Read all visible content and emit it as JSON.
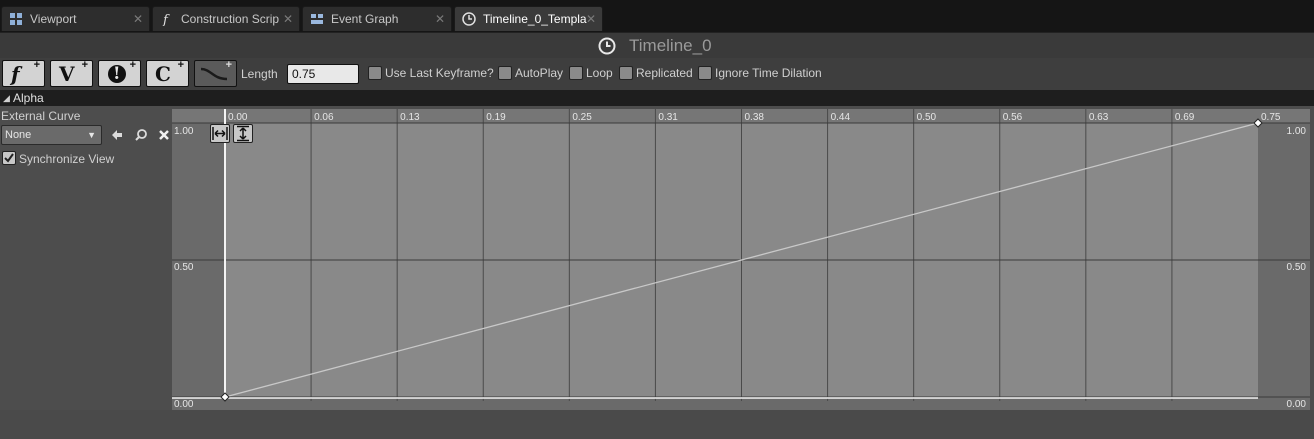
{
  "tabs": [
    {
      "label": "Viewport",
      "icon": "viewport-icon",
      "active": false
    },
    {
      "label": "Construction Scrip",
      "icon": "function-icon",
      "active": false
    },
    {
      "label": "Event Graph",
      "icon": "event-graph-icon",
      "active": false
    },
    {
      "label": "Timeline_0_Templa",
      "icon": "clock-icon",
      "active": true
    }
  ],
  "close_glyph": "✕",
  "title": "Timeline_0",
  "toolbar": {
    "add_float_track": "f",
    "add_vector_track": "V",
    "add_event_track": "!",
    "add_color_track": "C",
    "plus": "+",
    "length_label": "Length",
    "length_value": "0.75",
    "options": [
      {
        "label": "Use Last Keyframe?",
        "checked": false
      },
      {
        "label": "AutoPlay",
        "checked": false
      },
      {
        "label": "Loop",
        "checked": false
      },
      {
        "label": "Replicated",
        "checked": false
      },
      {
        "label": "Ignore Time Dilation",
        "checked": false
      }
    ]
  },
  "track": {
    "name": "Alpha",
    "external_curve_label": "External Curve",
    "external_curve_value": "None",
    "synchronize_label": "Synchronize View",
    "synchronize_checked": true
  },
  "graph": {
    "x_ticks": [
      "0.00",
      "0.06",
      "0.13",
      "0.19",
      "0.25",
      "0.31",
      "0.38",
      "0.44",
      "0.50",
      "0.56",
      "0.63",
      "0.69",
      "0.75"
    ],
    "y_labels_left": [
      "1.00",
      "0.50",
      "0.00"
    ],
    "y_labels_right": [
      "1.00",
      "0.50",
      "0.00"
    ],
    "keys": [
      {
        "time": 0.0,
        "value": 0.0
      },
      {
        "time": 0.75,
        "value": 1.0
      }
    ],
    "time_range": [
      0.0,
      0.75
    ],
    "value_range": [
      0.0,
      1.0
    ]
  },
  "colors": {
    "graph_bg": "#6e6e6e",
    "active_range_bg": "#898989",
    "curve": "#c8c8c8",
    "grid": "#4a4a4a"
  }
}
